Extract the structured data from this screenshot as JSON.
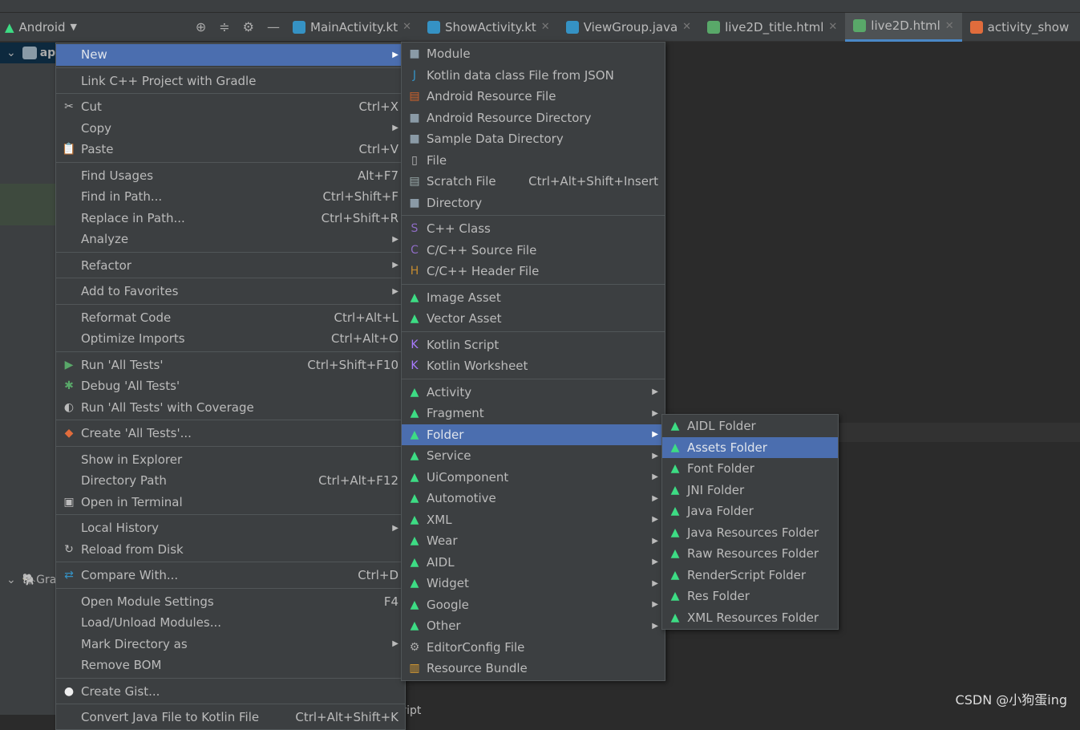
{
  "colors": {
    "highlight": "#4b6eaf",
    "menu_bg": "#3c3f41",
    "editor_bg": "#2b2b2b",
    "android_green": "#3ddc84"
  },
  "toolbar": {
    "project_view": "Android",
    "tabs": [
      {
        "label": "MainActivity.kt",
        "icon": "kotlin-class-icon"
      },
      {
        "label": "ShowActivity.kt",
        "icon": "kotlin-class-icon"
      },
      {
        "label": "ViewGroup.java",
        "icon": "java-class-icon"
      },
      {
        "label": "live2D_title.html",
        "icon": "html-file-icon"
      },
      {
        "label": "live2D.html",
        "icon": "html-file-icon",
        "active": true
      },
      {
        "label": "activity_show",
        "icon": "xml-file-icon"
      }
    ]
  },
  "tree": {
    "root": "app",
    "gradle": "Gra"
  },
  "menus": {
    "main": {
      "items": [
        {
          "label": "New",
          "submenu": true,
          "hl": true,
          "sep": true
        },
        {
          "label": "Link C++ Project with Gradle",
          "sep": true
        },
        {
          "label": "Cut",
          "shortcut": "Ctrl+X",
          "icon": "scissors"
        },
        {
          "label": "Copy",
          "submenu": true
        },
        {
          "label": "Paste",
          "shortcut": "Ctrl+V",
          "icon": "clipboard",
          "sep": true
        },
        {
          "label": "Find Usages",
          "shortcut": "Alt+F7"
        },
        {
          "label": "Find in Path...",
          "shortcut": "Ctrl+Shift+F"
        },
        {
          "label": "Replace in Path...",
          "shortcut": "Ctrl+Shift+R"
        },
        {
          "label": "Analyze",
          "submenu": true,
          "sep": true
        },
        {
          "label": "Refactor",
          "submenu": true,
          "sep": true
        },
        {
          "label": "Add to Favorites",
          "submenu": true,
          "sep": true
        },
        {
          "label": "Reformat Code",
          "shortcut": "Ctrl+Alt+L"
        },
        {
          "label": "Optimize Imports",
          "shortcut": "Ctrl+Alt+O",
          "sep": true
        },
        {
          "label": "Run 'All Tests'",
          "shortcut": "Ctrl+Shift+F10",
          "icon": "run"
        },
        {
          "label": "Debug 'All Tests'",
          "icon": "debug"
        },
        {
          "label": "Run 'All Tests' with Coverage",
          "icon": "coverage",
          "sep": true
        },
        {
          "label": "Create 'All Tests'...",
          "icon": "create-test",
          "sep": true
        },
        {
          "label": "Show in Explorer"
        },
        {
          "label": "Directory Path",
          "shortcut": "Ctrl+Alt+F12"
        },
        {
          "label": "Open in Terminal",
          "icon": "terminal",
          "sep": true
        },
        {
          "label": "Local History",
          "submenu": true
        },
        {
          "label": "Reload from Disk",
          "icon": "reload",
          "sep": true
        },
        {
          "label": "Compare With...",
          "shortcut": "Ctrl+D",
          "icon": "compare",
          "sep": true
        },
        {
          "label": "Open Module Settings",
          "shortcut": "F4"
        },
        {
          "label": "Load/Unload Modules..."
        },
        {
          "label": "Mark Directory as",
          "submenu": true
        },
        {
          "label": "Remove BOM",
          "sep": true
        },
        {
          "label": "Create Gist...",
          "icon": "github",
          "sep": true
        },
        {
          "label": "Convert Java File to Kotlin File",
          "shortcut": "Ctrl+Alt+Shift+K"
        }
      ]
    },
    "new": {
      "items": [
        {
          "label": "Module",
          "icon": "folder"
        },
        {
          "label": "Kotlin data class File from JSON",
          "icon": "json"
        },
        {
          "label": "Android Resource File",
          "icon": "android-res"
        },
        {
          "label": "Android Resource Directory",
          "icon": "folder"
        },
        {
          "label": "Sample Data Directory",
          "icon": "folder"
        },
        {
          "label": "File",
          "icon": "file"
        },
        {
          "label": "Scratch File",
          "shortcut": "Ctrl+Alt+Shift+Insert",
          "icon": "scratch"
        },
        {
          "label": "Directory",
          "icon": "folder",
          "sep": true
        },
        {
          "label": "C++ Class",
          "icon": "cpp-class"
        },
        {
          "label": "C/C++ Source File",
          "icon": "cpp-source"
        },
        {
          "label": "C/C++ Header File",
          "icon": "cpp-header",
          "sep": true
        },
        {
          "label": "Image Asset",
          "icon": "android"
        },
        {
          "label": "Vector Asset",
          "icon": "android",
          "sep": true
        },
        {
          "label": "Kotlin Script",
          "icon": "kotlin"
        },
        {
          "label": "Kotlin Worksheet",
          "icon": "kotlin",
          "sep": true
        },
        {
          "label": "Activity",
          "icon": "android",
          "submenu": true
        },
        {
          "label": "Fragment",
          "icon": "android",
          "submenu": true
        },
        {
          "label": "Folder",
          "icon": "android",
          "submenu": true,
          "hl": true
        },
        {
          "label": "Service",
          "icon": "android",
          "submenu": true
        },
        {
          "label": "UiComponent",
          "icon": "android",
          "submenu": true
        },
        {
          "label": "Automotive",
          "icon": "android",
          "submenu": true
        },
        {
          "label": "XML",
          "icon": "android",
          "submenu": true
        },
        {
          "label": "Wear",
          "icon": "android",
          "submenu": true
        },
        {
          "label": "AIDL",
          "icon": "android",
          "submenu": true
        },
        {
          "label": "Widget",
          "icon": "android",
          "submenu": true
        },
        {
          "label": "Google",
          "icon": "android",
          "submenu": true
        },
        {
          "label": "Other",
          "icon": "android",
          "submenu": true
        },
        {
          "label": "EditorConfig File",
          "icon": "gear"
        },
        {
          "label": "Resource Bundle",
          "icon": "bundle"
        }
      ]
    },
    "folder": {
      "items": [
        {
          "label": "AIDL Folder",
          "icon": "android-folder"
        },
        {
          "label": "Assets Folder",
          "icon": "android-folder",
          "hl": true
        },
        {
          "label": "Font Folder",
          "icon": "android-folder"
        },
        {
          "label": "JNI Folder",
          "icon": "android-folder"
        },
        {
          "label": "Java Folder",
          "icon": "android-folder"
        },
        {
          "label": "Java Resources Folder",
          "icon": "android-folder"
        },
        {
          "label": "Raw Resources Folder",
          "icon": "android-folder"
        },
        {
          "label": "RenderScript Folder",
          "icon": "android-folder"
        },
        {
          "label": "Res Folder",
          "icon": "android-folder"
        },
        {
          "label": "XML Resources Folder",
          "icon": "android-folder"
        }
      ]
    }
  },
  "editor": {
    "breadcrumb": "html  ›  script"
  },
  "watermark": "CSDN @小狗蛋ing"
}
